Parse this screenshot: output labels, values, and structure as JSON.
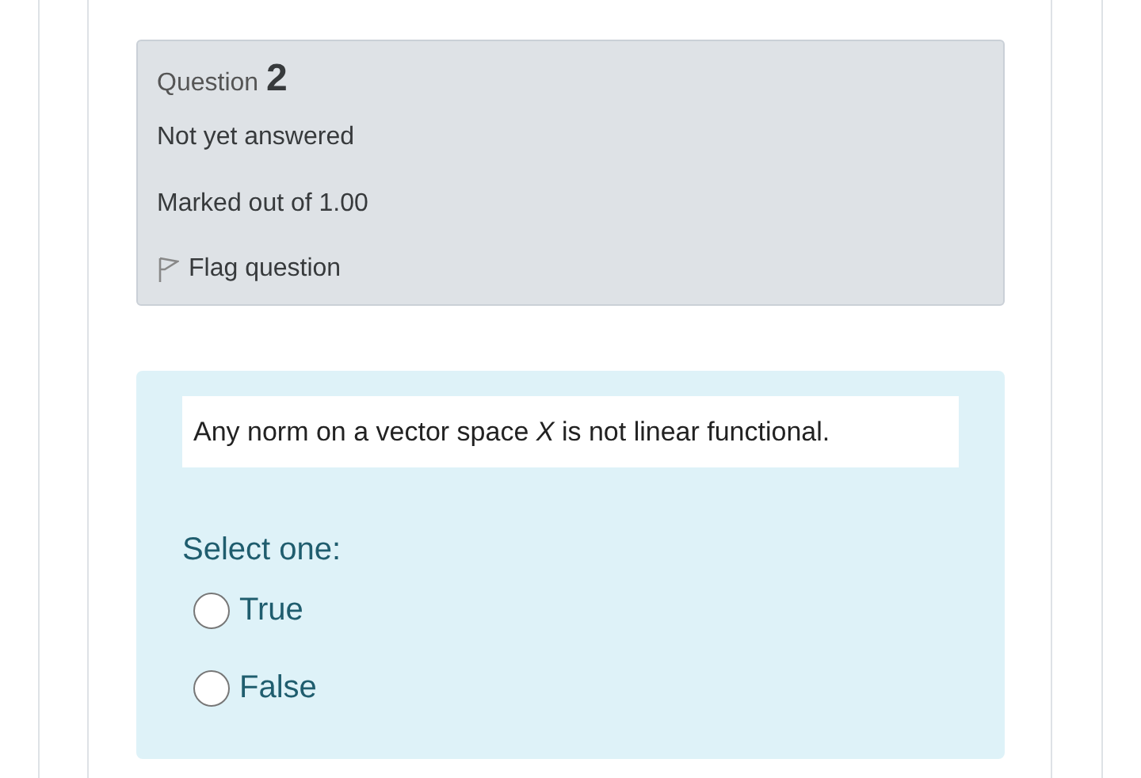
{
  "info": {
    "label": "Question",
    "number": "2",
    "state": "Not yet answered",
    "marks": "Marked out of 1.00",
    "flag": {
      "label": "Flag question",
      "flagged": false
    }
  },
  "question": {
    "text": "Any norm on a vector space *X*  is not linear functional.",
    "prompt": "Select one:",
    "options": [
      {
        "label": "True",
        "selected": false
      },
      {
        "label": "False",
        "selected": false
      }
    ]
  }
}
